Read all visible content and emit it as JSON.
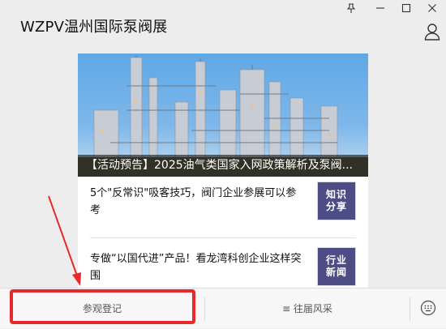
{
  "window": {
    "title": "WZPV温州国际泵阀展",
    "controls": {
      "pin": "⊥",
      "minimize": "−",
      "maximize": "□",
      "close": "✕"
    }
  },
  "feed": {
    "hero_caption": "【活动预告】2025油气类国家入网政策解析及泵阀...",
    "articles": [
      {
        "title": "5个\"反常识\"吸客技巧，阀门企业参展可以参考",
        "thumb_line1": "知识",
        "thumb_line2": "分享"
      },
      {
        "title": "专做“以国代进”产品！看龙湾科创企业这样突围",
        "thumb_line1": "行业",
        "thumb_line2": "新闻"
      }
    ]
  },
  "bottom_menu": {
    "items": [
      {
        "label": "参观登记"
      },
      {
        "label": "≡ 往届风采"
      }
    ]
  },
  "colors": {
    "highlight": "#e8292c",
    "thumb_bg": "#4d4d86"
  }
}
